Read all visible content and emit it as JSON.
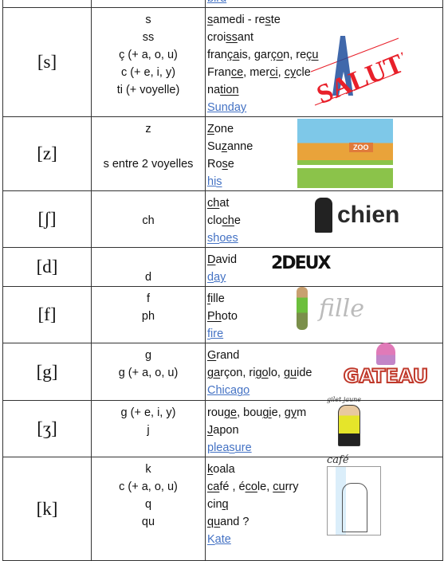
{
  "rows": [
    {
      "symbol": "",
      "spellings": [],
      "examples": [
        [
          {
            "t": "bird",
            "u": false,
            "en": true
          }
        ]
      ]
    },
    {
      "symbol": "[s]",
      "spellings": [
        "s",
        "ss",
        "ç (+ a, o, u)",
        "c (+ e, i, y)",
        "ti (+ voyelle)"
      ],
      "examples": [
        [
          {
            "t": "s",
            "u": true
          },
          {
            "t": "amedi - re"
          },
          {
            "t": "s",
            "u": true
          },
          {
            "t": "te"
          }
        ],
        [
          {
            "t": "croi"
          },
          {
            "t": "ss",
            "u": true
          },
          {
            "t": "ant"
          }
        ],
        [
          {
            "t": "fran"
          },
          {
            "t": "ça",
            "u": true
          },
          {
            "t": "is, gar"
          },
          {
            "t": "ço",
            "u": true
          },
          {
            "t": "n, re"
          },
          {
            "t": "çu",
            "u": true
          }
        ],
        [
          {
            "t": "Fran"
          },
          {
            "t": "ce",
            "u": true
          },
          {
            "t": ", mer"
          },
          {
            "t": "ci",
            "u": true
          },
          {
            "t": ", "
          },
          {
            "t": "cy",
            "u": true
          },
          {
            "t": "cle"
          }
        ],
        [
          {
            "t": "na"
          },
          {
            "t": "tion",
            "u": true
          }
        ],
        [
          {
            "t": "Sunday",
            "en": true
          }
        ]
      ],
      "image": {
        "label": "SALUT!",
        "kind": "salut"
      }
    },
    {
      "symbol": "[z]",
      "spellings": [
        "z",
        "",
        "s entre 2 voyelles"
      ],
      "examples": [
        [
          {
            "t": "Z",
            "u": true
          },
          {
            "t": "one"
          }
        ],
        [
          {
            "t": "Su"
          },
          {
            "t": "z",
            "u": true
          },
          {
            "t": "anne"
          }
        ],
        [
          {
            "t": "Ro"
          },
          {
            "t": "s",
            "u": true
          },
          {
            "t": "e"
          }
        ],
        [
          {
            "t": "hi",
            "en": true
          },
          {
            "t": "s",
            "u": true,
            "en": true
          }
        ]
      ],
      "image": {
        "label": "ZOO",
        "kind": "zoo"
      }
    },
    {
      "symbol": "[ʃ]",
      "spellings": [
        "",
        "ch"
      ],
      "examples": [
        [
          {
            "t": "ch",
            "u": true
          },
          {
            "t": "at"
          }
        ],
        [
          {
            "t": "clo"
          },
          {
            "t": "ch",
            "u": true
          },
          {
            "t": "e"
          }
        ],
        [
          {
            "t": "sh",
            "u": true,
            "en": true
          },
          {
            "t": "oes",
            "en": true
          }
        ]
      ],
      "image": {
        "label": "chien",
        "kind": "chien"
      }
    },
    {
      "symbol": "[d]",
      "spellings": [
        "",
        "d"
      ],
      "examples": [
        [
          {
            "t": "D",
            "u": true
          },
          {
            "t": "avid"
          }
        ],
        [
          {
            "t": "d",
            "u": true,
            "en": true
          },
          {
            "t": "ay",
            "en": true
          }
        ]
      ],
      "image": {
        "label": "2DEUX",
        "kind": "deux"
      }
    },
    {
      "symbol": "[f]",
      "spellings": [
        "f",
        "ph"
      ],
      "examples": [
        [
          {
            "t": "f",
            "u": true
          },
          {
            "t": "ille"
          }
        ],
        [
          {
            "t": "Ph",
            "u": true
          },
          {
            "t": "oto"
          }
        ],
        [
          {
            "t": "f",
            "u": true,
            "en": true
          },
          {
            "t": "ire",
            "en": true
          }
        ]
      ],
      "image": {
        "label": "fille",
        "kind": "fille"
      }
    },
    {
      "symbol": "[g]",
      "spellings": [
        "g",
        "g (+ a, o, u)"
      ],
      "examples": [
        [
          {
            "t": "G",
            "u": true
          },
          {
            "t": "rand"
          }
        ],
        [
          {
            "t": "ga",
            "u": true
          },
          {
            "t": "rçon, ri"
          },
          {
            "t": "go",
            "u": true
          },
          {
            "t": "lo, "
          },
          {
            "t": "gu",
            "u": true
          },
          {
            "t": "ide"
          }
        ],
        [
          {
            "t": "Chica",
            "en": true
          },
          {
            "t": "g",
            "u": true,
            "en": true
          },
          {
            "t": "o",
            "en": true
          }
        ]
      ],
      "image": {
        "label": "GATEAU",
        "kind": "gateau"
      }
    },
    {
      "symbol": "[ʒ]",
      "spellings": [
        "g (+ e, i, y)",
        "j"
      ],
      "examples": [
        [
          {
            "t": "rou"
          },
          {
            "t": "ge",
            "u": true
          },
          {
            "t": ", bou"
          },
          {
            "t": "gi",
            "u": true
          },
          {
            "t": "e, "
          },
          {
            "t": "gy",
            "u": true
          },
          {
            "t": "m"
          }
        ],
        [
          {
            "t": "J",
            "u": true
          },
          {
            "t": "apon"
          }
        ],
        [
          {
            "t": "plea",
            "en": true
          },
          {
            "t": "s",
            "u": true,
            "en": true
          },
          {
            "t": "ure",
            "en": true
          }
        ]
      ],
      "image": {
        "label": "gilet jaune",
        "kind": "gilet"
      }
    },
    {
      "symbol": "[k]",
      "spellings": [
        "k",
        "c (+ a, o, u)",
        "q",
        "qu"
      ],
      "examples": [
        [
          {
            "t": "k",
            "u": true
          },
          {
            "t": "oala"
          }
        ],
        [
          {
            "t": "ca",
            "u": true
          },
          {
            "t": "fé , é"
          },
          {
            "t": "co",
            "u": true
          },
          {
            "t": "le, "
          },
          {
            "t": "cu",
            "u": true
          },
          {
            "t": "rry"
          }
        ],
        [
          {
            "t": "cin"
          },
          {
            "t": "q",
            "u": true
          }
        ],
        [
          {
            "t": "qu",
            "u": true
          },
          {
            "t": "and ?"
          }
        ],
        [
          {
            "t": "K",
            "u": true,
            "en": true
          },
          {
            "t": "ate",
            "en": true
          }
        ]
      ],
      "image": {
        "label": "café",
        "kind": "cafe"
      }
    }
  ],
  "colors": {
    "english_link": "#4472c4",
    "border": "#333333",
    "salut_red": "#e8202a",
    "salut_blue": "#1f4e9c",
    "gateau": "#c0392b"
  }
}
